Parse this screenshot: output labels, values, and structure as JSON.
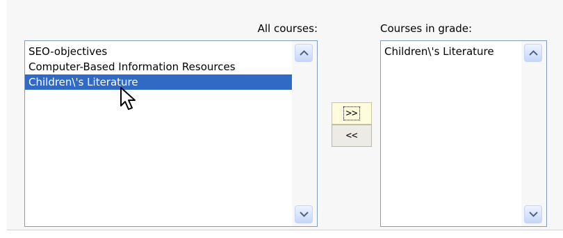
{
  "all_courses": {
    "header": "All courses:",
    "options": [
      "SEO-objectives",
      "Computer-Based Information Resources",
      "Children\\'s Literature"
    ],
    "selected_index": 2
  },
  "grade_courses": {
    "header": "Courses in grade:",
    "options": [
      "Children\\'s Literature"
    ]
  },
  "buttons": {
    "add_label": ">>",
    "remove_label": "<<"
  },
  "icons": {
    "scroll_up": "scroll-up-arrow-icon",
    "scroll_down": "scroll-down-arrow-icon",
    "cursor": "mouse-pointer-icon"
  },
  "colors": {
    "selection": "#316ac5",
    "listbox_border": "#7f9db9",
    "focused_button": "#fffbdc"
  }
}
